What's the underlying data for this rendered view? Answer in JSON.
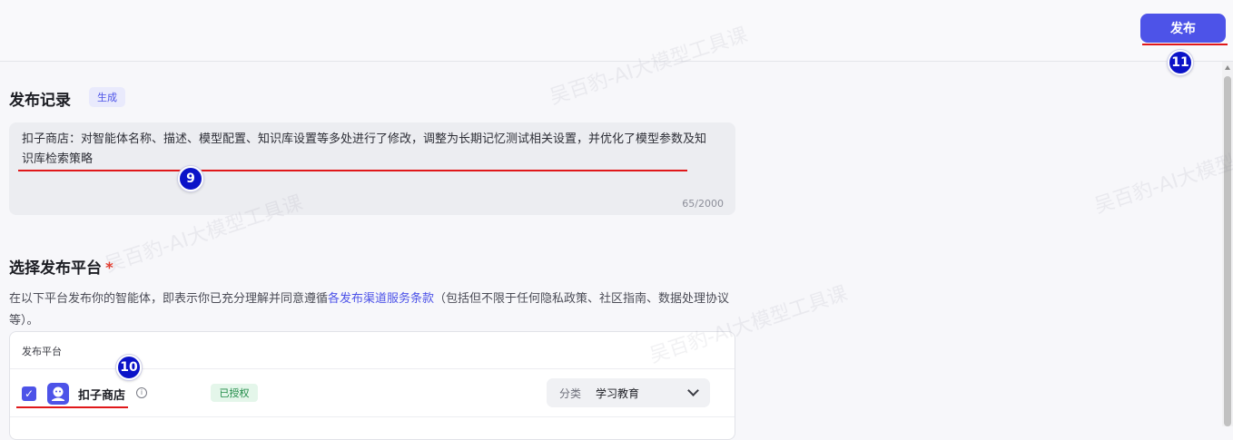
{
  "header": {
    "publish_label": "发布"
  },
  "annotations": {
    "step_9": "9",
    "step_10": "10",
    "step_11": "11"
  },
  "publish_record": {
    "title": "发布记录",
    "generate_tag": "生成",
    "description": "扣子商店：对智能体名称、描述、模型配置、知识库设置等多处进行了修改，调整为长期记忆测试相关设置，并优化了模型参数及知识库检索策略",
    "char_count": "65/2000"
  },
  "platform_section": {
    "title": "选择发布平台",
    "required_mark": "*",
    "agreement_prefix": "在以下平台发布你的智能体，即表示你已充分理解并同意遵循",
    "agreement_link": "各发布渠道服务条款",
    "agreement_suffix": "（包括但不限于任何隐私政策、社区指南、数据处理协议等）。",
    "table_header": "发布平台",
    "platforms": [
      {
        "name": "扣子商店",
        "checked": true,
        "status": "已授权",
        "category_label": "分类",
        "category_value": "学习教育"
      }
    ]
  },
  "watermark_text": "吴百豹-AI大模型工具课",
  "colors": {
    "accent": "#4d53e8",
    "annotation_red": "#e0181a",
    "annotation_badge": "#0b13c8",
    "authorized_green": "#1f8a46"
  }
}
